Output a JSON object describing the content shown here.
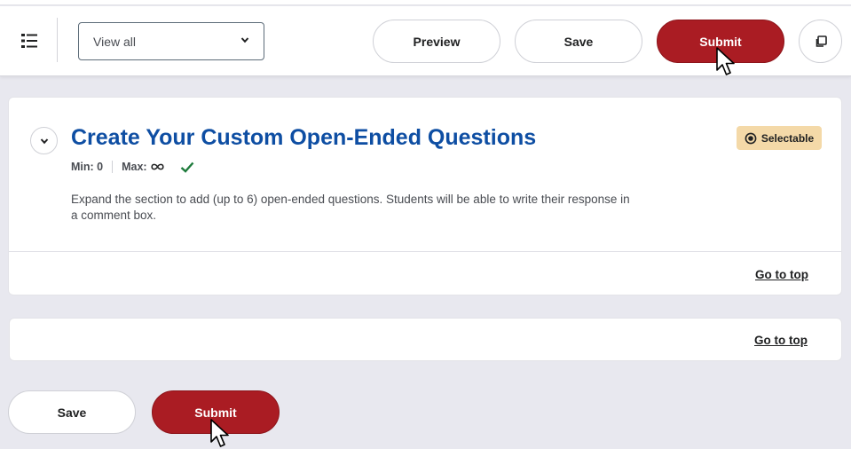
{
  "toolbar": {
    "list_toggle_icon": "list-toggle-icon",
    "view_select": {
      "selected": "View all"
    },
    "preview_label": "Preview",
    "save_label": "Save",
    "submit_label": "Submit",
    "copy_icon": "copy-icon"
  },
  "section": {
    "title": "Create Your Custom Open-Ended Questions",
    "min": "Min: 0",
    "max": "Max:",
    "badge": "Selectable",
    "description": "Expand the section to add (up to 6) open-ended questions. Students will be able to write their response in a comment box.",
    "go_to_top": "Go to top"
  },
  "footer_card": {
    "go_to_top": "Go to top"
  },
  "bottom_actions": {
    "save_label": "Save",
    "submit_label": "Submit"
  },
  "colors": {
    "accent_red": "#aa1c23",
    "title_blue": "#0e4ea3",
    "badge_bg": "#f4d9a8",
    "check_green": "#1e7b3c",
    "page_bg": "#e8e8ef"
  }
}
